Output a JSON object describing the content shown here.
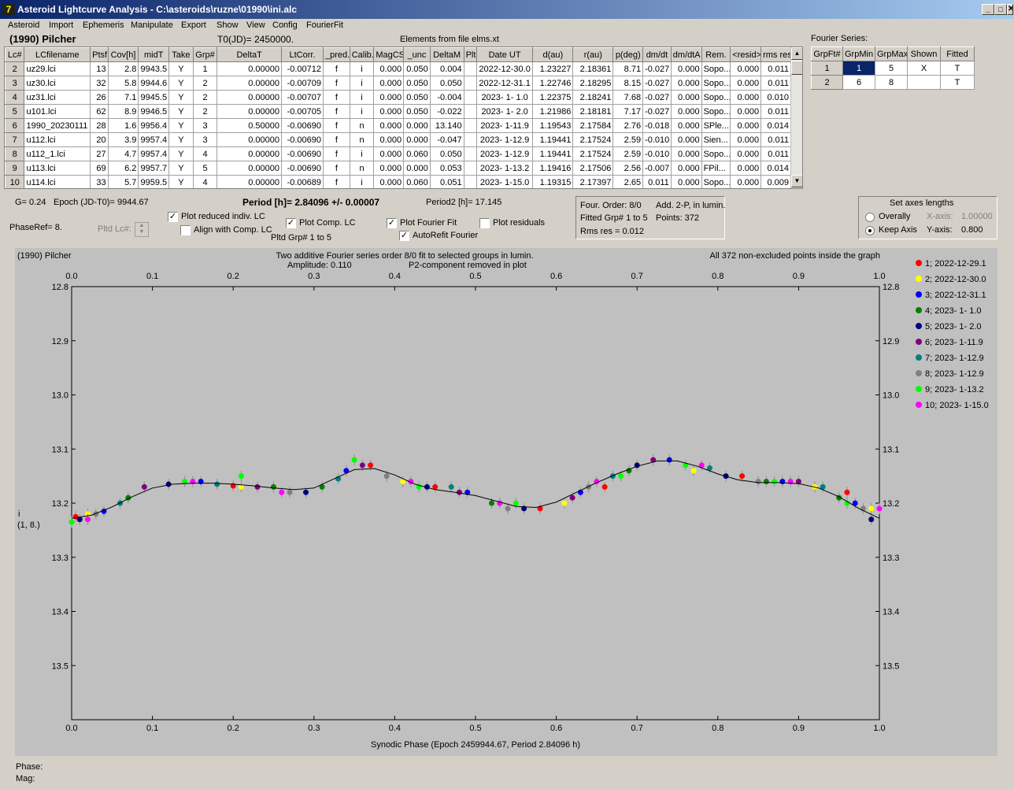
{
  "window": {
    "title": "Asteroid Lightcurve Analysis - C:\\asteroids\\ruzne\\01990\\ini.alc",
    "minimize": "_",
    "maximize": "□",
    "close": "✕"
  },
  "menu": [
    "Asteroid",
    "Import",
    "Ephemeris",
    "Manipulate",
    "Export",
    "Show",
    "View",
    "Config",
    "FourierFit"
  ],
  "header": {
    "asteroid": "(1990) Pilcher",
    "t0": "T0(JD)= 2450000.",
    "elements": "Elements from file elms.xt"
  },
  "lc_table": {
    "columns": [
      "Lc#",
      "LCfilename",
      "Ptsf",
      "Cov[h]",
      "midT",
      "Take",
      "Grp#",
      "DeltaT",
      "LtCorr.",
      "_pred.",
      "Calib.",
      "MagCS",
      "_unc",
      "DeltaM",
      "Plt",
      "Date UT",
      "d(au)",
      "r(au)",
      "p(deg)",
      "dm/dt",
      "dm/dtA",
      "Rem.",
      "<resid>",
      "rms res"
    ],
    "rows": [
      [
        "2",
        "uz29.lci",
        "13",
        "2.8",
        "9943.5",
        "Y",
        "1",
        "0.00000",
        "-0.00712",
        "f",
        "i",
        "0.000",
        "0.050",
        "0.004",
        "",
        "2022-12-30.0",
        "1.23227",
        "2.18361",
        "8.71",
        "-0.027",
        "0.000",
        "Sopo...",
        "0.000",
        "0.011"
      ],
      [
        "3",
        "uz30.lci",
        "32",
        "5.8",
        "9944.6",
        "Y",
        "2",
        "0.00000",
        "-0.00709",
        "f",
        "i",
        "0.000",
        "0.050",
        "0.050",
        "",
        "2022-12-31.1",
        "1.22746",
        "2.18295",
        "8.15",
        "-0.027",
        "0.000",
        "Sopo...",
        "0.000",
        "0.011"
      ],
      [
        "4",
        "uz31.lci",
        "26",
        "7.1",
        "9945.5",
        "Y",
        "2",
        "0.00000",
        "-0.00707",
        "f",
        "i",
        "0.000",
        "0.050",
        "-0.004",
        "",
        "2023- 1- 1.0",
        "1.22375",
        "2.18241",
        "7.68",
        "-0.027",
        "0.000",
        "Sopo...",
        "0.000",
        "0.010"
      ],
      [
        "5",
        "u101.lci",
        "62",
        "8.9",
        "9946.5",
        "Y",
        "2",
        "0.00000",
        "-0.00705",
        "f",
        "i",
        "0.000",
        "0.050",
        "-0.022",
        "",
        "2023- 1- 2.0",
        "1.21986",
        "2.18181",
        "7.17",
        "-0.027",
        "0.000",
        "Sopo...",
        "0.000",
        "0.011"
      ],
      [
        "6",
        "1990_20230111",
        "28",
        "1.6",
        "9956.4",
        "Y",
        "3",
        "0.50000",
        "-0.00690",
        "f",
        "n",
        "0.000",
        "0.000",
        "13.140",
        "",
        "2023- 1-11.9",
        "1.19543",
        "2.17584",
        "2.76",
        "-0.018",
        "0.000",
        "SPle...",
        "0.000",
        "0.014"
      ],
      [
        "7",
        "u112.lci",
        "20",
        "3.9",
        "9957.4",
        "Y",
        "3",
        "0.00000",
        "-0.00690",
        "f",
        "n",
        "0.000",
        "0.000",
        "-0.047",
        "",
        "2023- 1-12.9",
        "1.19441",
        "2.17524",
        "2.59",
        "-0.010",
        "0.000",
        "Sien...",
        "0.000",
        "0.011"
      ],
      [
        "8",
        "u112_1.lci",
        "27",
        "4.7",
        "9957.4",
        "Y",
        "4",
        "0.00000",
        "-0.00690",
        "f",
        "i",
        "0.000",
        "0.060",
        "0.050",
        "",
        "2023- 1-12.9",
        "1.19441",
        "2.17524",
        "2.59",
        "-0.010",
        "0.000",
        "Sopo...",
        "0.000",
        "0.011"
      ],
      [
        "9",
        "u113.lci",
        "69",
        "6.2",
        "9957.7",
        "Y",
        "5",
        "0.00000",
        "-0.00690",
        "f",
        "n",
        "0.000",
        "0.000",
        "0.053",
        "",
        "2023- 1-13.2",
        "1.19416",
        "2.17506",
        "2.56",
        "-0.007",
        "0.000",
        "FPil...",
        "0.000",
        "0.014"
      ],
      [
        "10",
        "u114.lci",
        "33",
        "5.7",
        "9959.5",
        "Y",
        "4",
        "0.00000",
        "-0.00689",
        "f",
        "i",
        "0.000",
        "0.060",
        "0.051",
        "",
        "2023- 1-15.0",
        "1.19315",
        "2.17397",
        "2.65",
        "0.011",
        "0.000",
        "Sopo...",
        "0.000",
        "0.009"
      ]
    ]
  },
  "fourier_table": {
    "title": "Fourier Series:",
    "columns": [
      "GrpFt#",
      "GrpMin",
      "GrpMax",
      "Shown",
      "Fitted"
    ],
    "rows": [
      [
        "1",
        "1",
        "5",
        "X",
        "T"
      ],
      [
        "2",
        "6",
        "8",
        "",
        "T"
      ]
    ]
  },
  "controls": {
    "g": "G= 0.24",
    "epoch": "Epoch (JD-T0)= 9944.67",
    "period": "Period [h]= 2.84096 +/- 0.00007",
    "period2": "Period2 [h]= 17.145",
    "phaseref": "PhaseRef= 8.",
    "pltd_lc": "Pltd Lc#:",
    "plot_reduced": "Plot reduced indiv. LC",
    "align": "Align with Comp. LC",
    "plot_comp": "Plot Comp. LC",
    "pltd_grp": "Pltd Grp#  1   to   5",
    "plot_fourier": "Plot Fourier Fit",
    "autorefit": "AutoRefit Fourier",
    "plot_residuals": "Plot residuals",
    "plot_reduced_checked": true,
    "align_checked": false,
    "plot_comp_checked": true,
    "plot_fourier_checked": true,
    "autorefit_checked": true,
    "plot_residuals_checked": false
  },
  "fit_info": {
    "order": "Four. Order:  8/0",
    "add": "Add. 2-P, in lumin.",
    "fitted": "Fitted Grp# 1 to 5",
    "points": "Points: 372",
    "rms": "Rms res     = 0.012"
  },
  "axes_lengths": {
    "title": "Set axes lengths",
    "overally": "Overally",
    "keep": "Keep Axis",
    "xaxis": "X-axis:",
    "xval": "1.00000",
    "yaxis": "Y-axis:",
    "yval": "0.800"
  },
  "chart_data": {
    "type": "scatter",
    "title_left": "(1990) Pilcher",
    "title_center": "Two additive Fourier series order 8/0 fit to selected groups in lumin.",
    "amplitude": "Amplitude: 0.110",
    "p2_note": "P2-component removed in plot",
    "title_right": "All 372 non-excluded points inside the graph",
    "xlabel": "Synodic Phase (Epoch 2459944.67, Period 2.84096 h)",
    "ylabel": "i",
    "ylabel2": "(1, 8.)",
    "xlim": [
      0,
      1
    ],
    "ylim": [
      12.8,
      13.6
    ],
    "y_inverted": true,
    "x_ticks": [
      "0.0",
      "0.1",
      "0.2",
      "0.3",
      "0.4",
      "0.5",
      "0.6",
      "0.7",
      "0.8",
      "0.9",
      "1.0"
    ],
    "y_ticks": [
      "12.8",
      "12.9",
      "13.0",
      "13.1",
      "13.2",
      "13.3",
      "13.4",
      "13.5"
    ],
    "legend_position": "right",
    "fit_curve": {
      "x": [
        0.0,
        0.025,
        0.05,
        0.075,
        0.1,
        0.125,
        0.15,
        0.175,
        0.2,
        0.225,
        0.25,
        0.275,
        0.3,
        0.325,
        0.35,
        0.375,
        0.4,
        0.425,
        0.45,
        0.475,
        0.5,
        0.525,
        0.55,
        0.575,
        0.6,
        0.625,
        0.65,
        0.675,
        0.7,
        0.725,
        0.75,
        0.775,
        0.8,
        0.825,
        0.85,
        0.875,
        0.9,
        0.925,
        0.95,
        0.975,
        1.0
      ],
      "y": [
        13.228,
        13.222,
        13.207,
        13.188,
        13.172,
        13.165,
        13.163,
        13.163,
        13.165,
        13.168,
        13.172,
        13.175,
        13.172,
        13.155,
        13.138,
        13.136,
        13.148,
        13.165,
        13.175,
        13.18,
        13.186,
        13.196,
        13.206,
        13.208,
        13.198,
        13.18,
        13.162,
        13.146,
        13.132,
        13.122,
        13.122,
        13.132,
        13.146,
        13.157,
        13.162,
        13.162,
        13.164,
        13.172,
        13.188,
        13.21,
        13.228
      ]
    },
    "series": [
      {
        "name": "1; 2022-12-29.1",
        "color": "#ff0000",
        "x": [
          0.005,
          0.2,
          0.37,
          0.45,
          0.58,
          0.66,
          0.83,
          0.96
        ],
        "y": [
          13.225,
          13.168,
          13.13,
          13.17,
          13.21,
          13.17,
          13.15,
          13.18
        ]
      },
      {
        "name": "2; 2022-12-30.0",
        "color": "#ffff00",
        "x": [
          0.02,
          0.21,
          0.41,
          0.61,
          0.77,
          0.92,
          0.99
        ],
        "y": [
          13.22,
          13.17,
          13.16,
          13.2,
          13.14,
          13.17,
          13.21
        ]
      },
      {
        "name": "3; 2022-12-31.1",
        "color": "#0000ff",
        "x": [
          0.04,
          0.16,
          0.34,
          0.49,
          0.63,
          0.74,
          0.88,
          0.97
        ],
        "y": [
          13.215,
          13.16,
          13.14,
          13.18,
          13.18,
          13.12,
          13.16,
          13.2
        ]
      },
      {
        "name": "4; 2023- 1- 1.0",
        "color": "#008000",
        "x": [
          0.07,
          0.25,
          0.31,
          0.52,
          0.69,
          0.86,
          0.95
        ],
        "y": [
          13.19,
          13.17,
          13.17,
          13.2,
          13.14,
          13.16,
          13.19
        ]
      },
      {
        "name": "5; 2023- 1- 2.0",
        "color": "#000080",
        "x": [
          0.01,
          0.12,
          0.29,
          0.44,
          0.56,
          0.7,
          0.81,
          0.99
        ],
        "y": [
          13.23,
          13.165,
          13.18,
          13.17,
          13.21,
          13.13,
          13.15,
          13.23
        ]
      },
      {
        "name": "6; 2023- 1-11.9",
        "color": "#800080",
        "x": [
          0.09,
          0.23,
          0.36,
          0.48,
          0.62,
          0.72,
          0.9
        ],
        "y": [
          13.17,
          13.17,
          13.13,
          13.18,
          13.19,
          13.12,
          13.16
        ]
      },
      {
        "name": "7; 2023- 1-12.9",
        "color": "#008080",
        "x": [
          0.06,
          0.18,
          0.33,
          0.47,
          0.67,
          0.79,
          0.93
        ],
        "y": [
          13.2,
          13.165,
          13.155,
          13.17,
          13.15,
          13.135,
          13.17
        ]
      },
      {
        "name": "8; 2023- 1-12.9",
        "color": "#808080",
        "x": [
          0.03,
          0.27,
          0.39,
          0.54,
          0.64,
          0.85,
          0.98
        ],
        "y": [
          13.22,
          13.18,
          13.15,
          13.21,
          13.17,
          13.16,
          13.21
        ]
      },
      {
        "name": "9; 2023- 1-13.2",
        "color": "#00ff00",
        "x": [
          0.0,
          0.14,
          0.21,
          0.35,
          0.43,
          0.55,
          0.68,
          0.76,
          0.87,
          0.96
        ],
        "y": [
          13.235,
          13.16,
          13.15,
          13.12,
          13.17,
          13.2,
          13.15,
          13.13,
          13.16,
          13.2
        ]
      },
      {
        "name": "10; 2023- 1-15.0",
        "color": "#ff00ff",
        "x": [
          0.02,
          0.15,
          0.26,
          0.42,
          0.53,
          0.65,
          0.78,
          0.89,
          1.0
        ],
        "y": [
          13.23,
          13.16,
          13.18,
          13.16,
          13.2,
          13.16,
          13.13,
          13.16,
          13.21
        ]
      }
    ]
  },
  "status": {
    "phase": "Phase:",
    "mag": "Mag:"
  }
}
